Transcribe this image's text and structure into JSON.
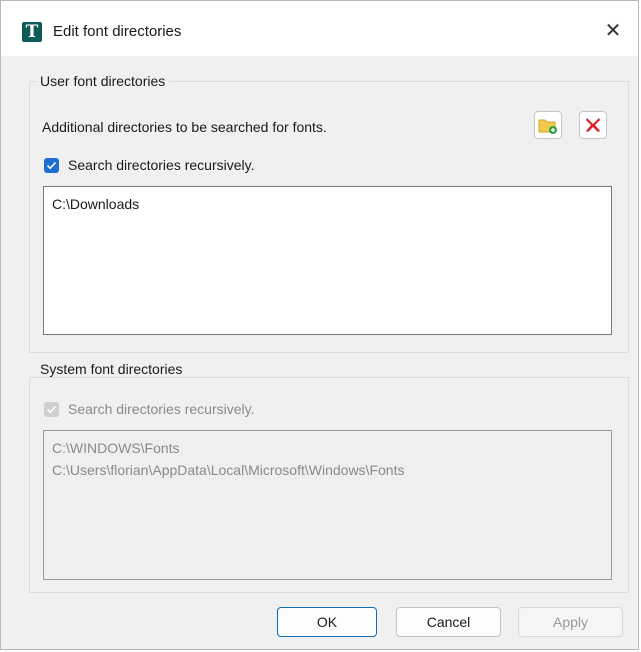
{
  "window": {
    "title": "Edit font directories",
    "app_icon_letter": "T",
    "close_glyph": "✕"
  },
  "user_group": {
    "legend": "User font directories",
    "description": "Additional directories to be searched for fonts.",
    "add_button_icon": "folder-add-icon",
    "remove_button_icon": "red-x-icon",
    "recursive_label": "Search directories recursively.",
    "recursive_checked": true,
    "directories": [
      "C:\\Downloads"
    ]
  },
  "system_group": {
    "legend": "System font directories",
    "recursive_label": "Search directories recursively.",
    "recursive_checked": true,
    "enabled": false,
    "directories": [
      "C:\\WINDOWS\\Fonts",
      "C:\\Users\\florian\\AppData\\Local\\Microsoft\\Windows\\Fonts"
    ]
  },
  "buttons": {
    "ok": "OK",
    "cancel": "Cancel",
    "apply": "Apply"
  },
  "colors": {
    "accent": "#1f6fd1",
    "app_icon_bg": "#0e5b57",
    "remove_red": "#e01f1f",
    "folder_yellow": "#f2c94c"
  }
}
